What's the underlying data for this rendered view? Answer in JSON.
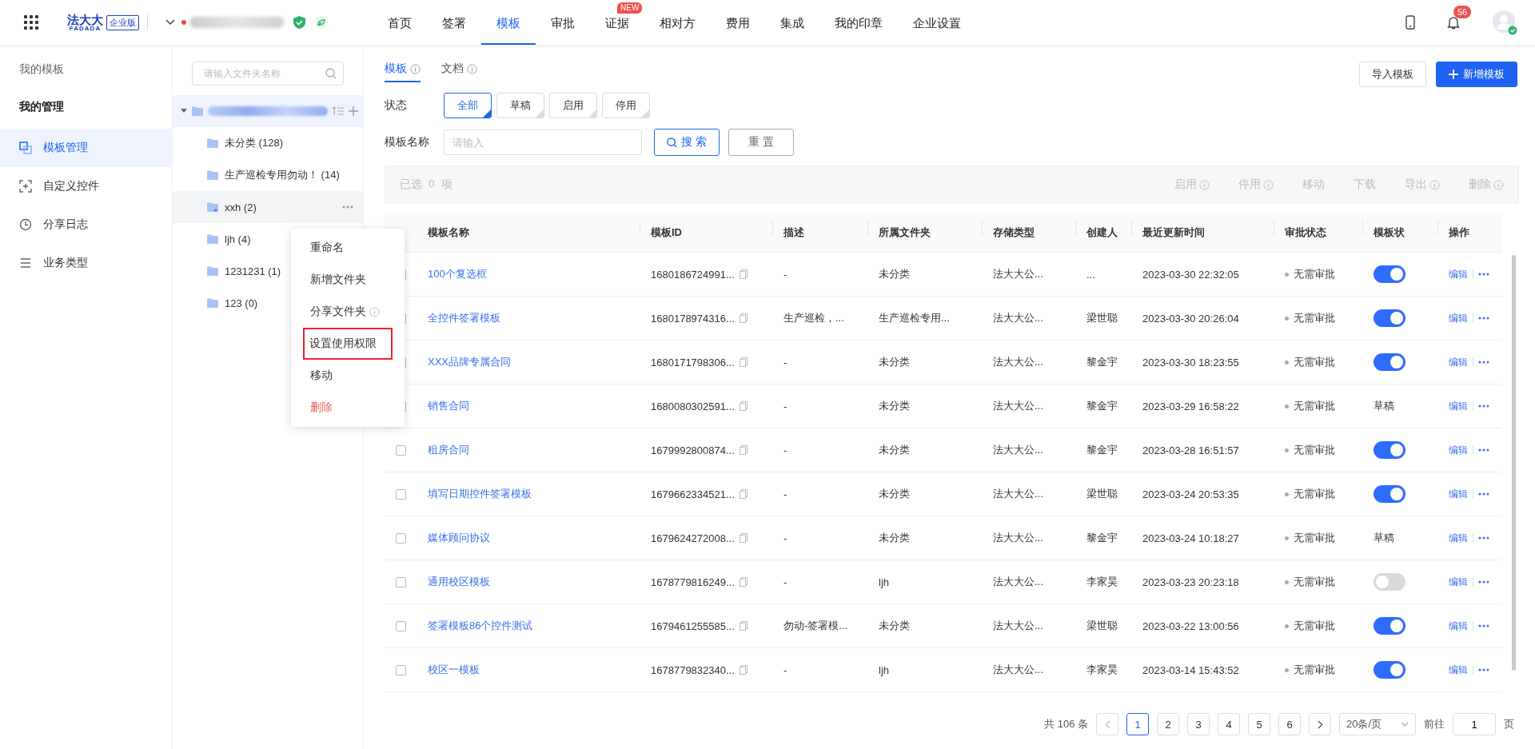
{
  "topbar": {
    "logo": {
      "cn": "法大大",
      "en": "FADADA",
      "edition": "企业版"
    },
    "nav": [
      {
        "label": "首页",
        "selected": false
      },
      {
        "label": "签署",
        "selected": false
      },
      {
        "label": "模板",
        "selected": true
      },
      {
        "label": "审批",
        "selected": false
      },
      {
        "label": "证据",
        "selected": false,
        "badge": "NEW"
      },
      {
        "label": "相对方",
        "selected": false
      },
      {
        "label": "费用",
        "selected": false
      },
      {
        "label": "集成",
        "selected": false
      },
      {
        "label": "我的印章",
        "selected": false
      },
      {
        "label": "企业设置",
        "selected": false
      }
    ],
    "notifications": "56"
  },
  "sidebar": {
    "section": "我的模板",
    "group": "我的管理",
    "items": [
      {
        "label": "模板管理",
        "selected": true
      },
      {
        "label": "自定义控件",
        "selected": false
      },
      {
        "label": "分享日志",
        "selected": false
      },
      {
        "label": "业务类型",
        "selected": false
      }
    ]
  },
  "folders": {
    "search": {
      "placeholder": "请输入文件夹名称"
    },
    "children": [
      {
        "label": "未分类 (128)",
        "selected": false
      },
      {
        "label": "生产巡检专用勿动！ (14)",
        "selected": false
      },
      {
        "label": "xxh (2)",
        "selected": true,
        "shared": true
      },
      {
        "label": "ljh (4)",
        "selected": false
      },
      {
        "label": "1231231 (1)",
        "selected": false
      },
      {
        "label": "123 (0)",
        "selected": false
      }
    ]
  },
  "context_menu": [
    {
      "label": "重命名",
      "kind": "normal",
      "highlighted": false
    },
    {
      "label": "新增文件夹",
      "kind": "normal",
      "highlighted": false
    },
    {
      "label": "分享文件夹",
      "kind": "info",
      "highlighted": false
    },
    {
      "label": "设置使用权限",
      "kind": "normal",
      "highlighted": true
    },
    {
      "label": "移动",
      "kind": "normal",
      "highlighted": false
    },
    {
      "label": "删除",
      "kind": "danger",
      "highlighted": false
    }
  ],
  "tabs": [
    {
      "label": "模板",
      "selected": true
    },
    {
      "label": "文档",
      "selected": false
    }
  ],
  "buttons": {
    "import": "导入模板",
    "create": "新增模板"
  },
  "status_filter": {
    "label": "状态",
    "options": [
      {
        "label": "全部",
        "selected": true
      },
      {
        "label": "草稿",
        "selected": false
      },
      {
        "label": "启用",
        "selected": false
      },
      {
        "label": "停用",
        "selected": false
      }
    ]
  },
  "name_filter": {
    "label": "模板名称",
    "placeholder": "请输入",
    "search": "搜 索",
    "reset": "重 置"
  },
  "bulk_bar": {
    "selected_prefix": "已选",
    "selected_count": "0",
    "selected_suffix": "项",
    "actions": [
      {
        "label": "启用",
        "info": true
      },
      {
        "label": "停用",
        "info": true
      },
      {
        "label": "移动",
        "info": false
      },
      {
        "label": "下载",
        "info": false
      },
      {
        "label": "导出",
        "info": true
      },
      {
        "label": "删除",
        "info": true
      }
    ]
  },
  "table": {
    "columns": [
      "模板名称",
      "模板ID",
      "描述",
      "所属文件夹",
      "存储类型",
      "创建人",
      "最近更新时间",
      "审批状态",
      "模板状",
      "操作"
    ],
    "rows": [
      {
        "checked": false,
        "name": "100个复选框",
        "id": "1680186724991...",
        "description": "-",
        "folder": "未分类",
        "storage": "法大大公...",
        "creator": "...",
        "updated": "2023-03-30 22:32:05",
        "approval": "无需审批",
        "on": true,
        "edit": "编辑"
      },
      {
        "checked": false,
        "name": "全控件签署模板",
        "id": "1680178974316...",
        "description": "生产巡检，...",
        "folder": "生产巡检专用...",
        "storage": "法大大公...",
        "creator": "梁世聪",
        "updated": "2023-03-30 20:26:04",
        "approval": "无需审批",
        "on": true,
        "edit": "编辑"
      },
      {
        "checked": false,
        "name": "XXX品牌专属合同",
        "id": "1680171798306...",
        "description": "-",
        "folder": "未分类",
        "storage": "法大大公...",
        "creator": "黎金宇",
        "updated": "2023-03-30 18:23:55",
        "approval": "无需审批",
        "on": true,
        "edit": "编辑"
      },
      {
        "checked": false,
        "name": "销售合同",
        "id": "1680080302591...",
        "description": "-",
        "folder": "未分类",
        "storage": "法大大公...",
        "creator": "黎金宇",
        "updated": "2023-03-29 16:58:22",
        "approval": "无需审批",
        "status_text": "草稿",
        "edit": "编辑"
      },
      {
        "checked": false,
        "name": "租房合同",
        "id": "1679992800874...",
        "description": "-",
        "folder": "未分类",
        "storage": "法大大公...",
        "creator": "黎金宇",
        "updated": "2023-03-28 16:51:57",
        "approval": "无需审批",
        "on": true,
        "edit": "编辑"
      },
      {
        "checked": false,
        "name": "填写日期控件签署模板",
        "id": "1679662334521...",
        "description": "-",
        "folder": "未分类",
        "storage": "法大大公...",
        "creator": "梁世聪",
        "updated": "2023-03-24 20:53:35",
        "approval": "无需审批",
        "on": true,
        "edit": "编辑"
      },
      {
        "checked": false,
        "name": "媒体顾问协议",
        "id": "1679624272008...",
        "description": "-",
        "folder": "未分类",
        "storage": "法大大公...",
        "creator": "黎金宇",
        "updated": "2023-03-24 10:18:27",
        "approval": "无需审批",
        "status_text": "草稿",
        "edit": "编辑"
      },
      {
        "checked": false,
        "name": "通用校区模板",
        "id": "1678779816249...",
        "description": "-",
        "folder": "ljh",
        "storage": "法大大公...",
        "creator": "李家昊",
        "updated": "2023-03-23 20:23:18",
        "approval": "无需审批",
        "on": false,
        "edit": "编辑"
      },
      {
        "checked": false,
        "name": "签署模板86个控件测试",
        "id": "1679461255585...",
        "description": "勿动-签署模...",
        "folder": "未分类",
        "storage": "法大大公...",
        "creator": "梁世聪",
        "updated": "2023-03-22 13:00:56",
        "approval": "无需审批",
        "on": true,
        "edit": "编辑"
      },
      {
        "checked": false,
        "name": "校区一模板",
        "id": "1678779832340...",
        "description": "-",
        "folder": "ljh",
        "storage": "法大大公...",
        "creator": "李家昊",
        "updated": "2023-03-14 15:43:52",
        "approval": "无需审批",
        "on": true,
        "edit": "编辑"
      }
    ]
  },
  "pagination": {
    "total": "共 106 条",
    "pages": [
      {
        "label": "1",
        "selected": true
      },
      {
        "label": "2",
        "selected": false
      },
      {
        "label": "3",
        "selected": false
      },
      {
        "label": "4",
        "selected": false
      },
      {
        "label": "5",
        "selected": false
      },
      {
        "label": "6",
        "selected": false
      }
    ],
    "page_size": "20条/页",
    "goto_label": "前往",
    "goto_value": "1",
    "goto_suffix": "页"
  }
}
